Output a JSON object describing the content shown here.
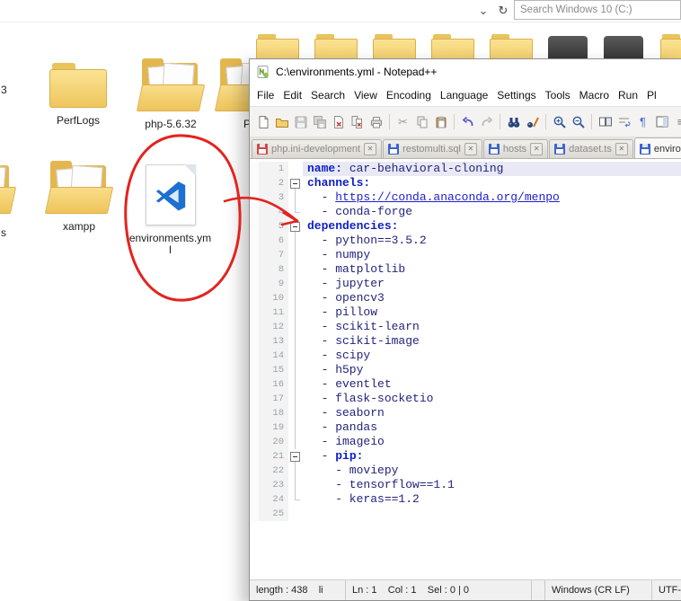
{
  "explorer": {
    "search_placeholder": "Search Windows 10 (C:)",
    "dropdown_icon": "⌄",
    "refresh_icon": "↻",
    "partial_labels": {
      "left_top": "3",
      "left_mid": "s",
      "right_partial": "P"
    },
    "items": {
      "perflogs": {
        "label": "PerfLogs"
      },
      "php": {
        "label": "php-5.6.32"
      },
      "xampp": {
        "label": "xampp"
      },
      "env_file": {
        "label_line1": "environments.ym",
        "label_line2": "l"
      }
    }
  },
  "notepad": {
    "title": "C:\\environments.yml - Notepad++",
    "menu": [
      "File",
      "Edit",
      "Search",
      "View",
      "Encoding",
      "Language",
      "Settings",
      "Tools",
      "Macro",
      "Run",
      "Pl"
    ],
    "toolbar_icon_names": [
      "new-file",
      "open-folder",
      "save",
      "save-all",
      "close-file",
      "close-all",
      "print",
      "cut",
      "copy",
      "paste",
      "undo",
      "redo",
      "find",
      "replace",
      "zoom-in",
      "zoom-out",
      "view-split",
      "word-wrap",
      "show-symbols",
      "doc-switcher"
    ],
    "tabs": [
      {
        "label": "php.ini-development",
        "modified": true,
        "active": false
      },
      {
        "label": "restomulti.sql",
        "modified": false,
        "active": false
      },
      {
        "label": "hosts",
        "modified": false,
        "active": false
      },
      {
        "label": "dataset.ts",
        "modified": false,
        "active": false
      },
      {
        "label": "environments.yml",
        "modified": false,
        "active": true
      }
    ],
    "status": {
      "length_info": "length : 438    li",
      "position": "Ln : 1    Col : 1    Sel : 0 | 0",
      "eol": "Windows (CR LF)",
      "encoding": "UTF-"
    }
  },
  "editor": {
    "current_line": 1,
    "lines": [
      {
        "n": 1,
        "fold": "none",
        "spans": [
          {
            "c": "key",
            "t": "name:"
          },
          {
            "c": "val",
            "t": " car-behavioral-cloning"
          }
        ]
      },
      {
        "n": 2,
        "fold": "box",
        "spans": [
          {
            "c": "key",
            "t": "channels:"
          }
        ]
      },
      {
        "n": 3,
        "fold": "line",
        "spans": [
          {
            "c": "val",
            "t": "  - "
          },
          {
            "c": "url",
            "t": "https://conda.anaconda.org/menpo"
          }
        ]
      },
      {
        "n": 4,
        "fold": "end",
        "spans": [
          {
            "c": "val",
            "t": "  - conda-forge"
          }
        ]
      },
      {
        "n": 5,
        "fold": "box",
        "spans": [
          {
            "c": "key",
            "t": "dependencies:"
          }
        ]
      },
      {
        "n": 6,
        "fold": "line",
        "spans": [
          {
            "c": "val",
            "t": "  - python==3.5.2"
          }
        ]
      },
      {
        "n": 7,
        "fold": "line",
        "spans": [
          {
            "c": "val",
            "t": "  - numpy"
          }
        ]
      },
      {
        "n": 8,
        "fold": "line",
        "spans": [
          {
            "c": "val",
            "t": "  - matplotlib"
          }
        ]
      },
      {
        "n": 9,
        "fold": "line",
        "spans": [
          {
            "c": "val",
            "t": "  - jupyter"
          }
        ]
      },
      {
        "n": 10,
        "fold": "line",
        "spans": [
          {
            "c": "val",
            "t": "  - opencv3"
          }
        ]
      },
      {
        "n": 11,
        "fold": "line",
        "spans": [
          {
            "c": "val",
            "t": "  - pillow"
          }
        ]
      },
      {
        "n": 12,
        "fold": "line",
        "spans": [
          {
            "c": "val",
            "t": "  - scikit-learn"
          }
        ]
      },
      {
        "n": 13,
        "fold": "line",
        "spans": [
          {
            "c": "val",
            "t": "  - scikit-image"
          }
        ]
      },
      {
        "n": 14,
        "fold": "line",
        "spans": [
          {
            "c": "val",
            "t": "  - scipy"
          }
        ]
      },
      {
        "n": 15,
        "fold": "line",
        "spans": [
          {
            "c": "val",
            "t": "  - h5py"
          }
        ]
      },
      {
        "n": 16,
        "fold": "line",
        "spans": [
          {
            "c": "val",
            "t": "  - eventlet"
          }
        ]
      },
      {
        "n": 17,
        "fold": "line",
        "spans": [
          {
            "c": "val",
            "t": "  - flask-socketio"
          }
        ]
      },
      {
        "n": 18,
        "fold": "line",
        "spans": [
          {
            "c": "val",
            "t": "  - seaborn"
          }
        ]
      },
      {
        "n": 19,
        "fold": "line",
        "spans": [
          {
            "c": "val",
            "t": "  - pandas"
          }
        ]
      },
      {
        "n": 20,
        "fold": "line",
        "spans": [
          {
            "c": "val",
            "t": "  - imageio"
          }
        ]
      },
      {
        "n": 21,
        "fold": "box",
        "spans": [
          {
            "c": "val",
            "t": "  - "
          },
          {
            "c": "key",
            "t": "pip:"
          }
        ]
      },
      {
        "n": 22,
        "fold": "line",
        "spans": [
          {
            "c": "val",
            "t": "    - moviepy"
          }
        ]
      },
      {
        "n": 23,
        "fold": "line",
        "spans": [
          {
            "c": "val",
            "t": "    - tensorflow==1.1"
          }
        ]
      },
      {
        "n": 24,
        "fold": "end",
        "spans": [
          {
            "c": "val",
            "t": "    - keras==1.2"
          }
        ]
      },
      {
        "n": 25,
        "fold": "none",
        "spans": []
      }
    ]
  }
}
